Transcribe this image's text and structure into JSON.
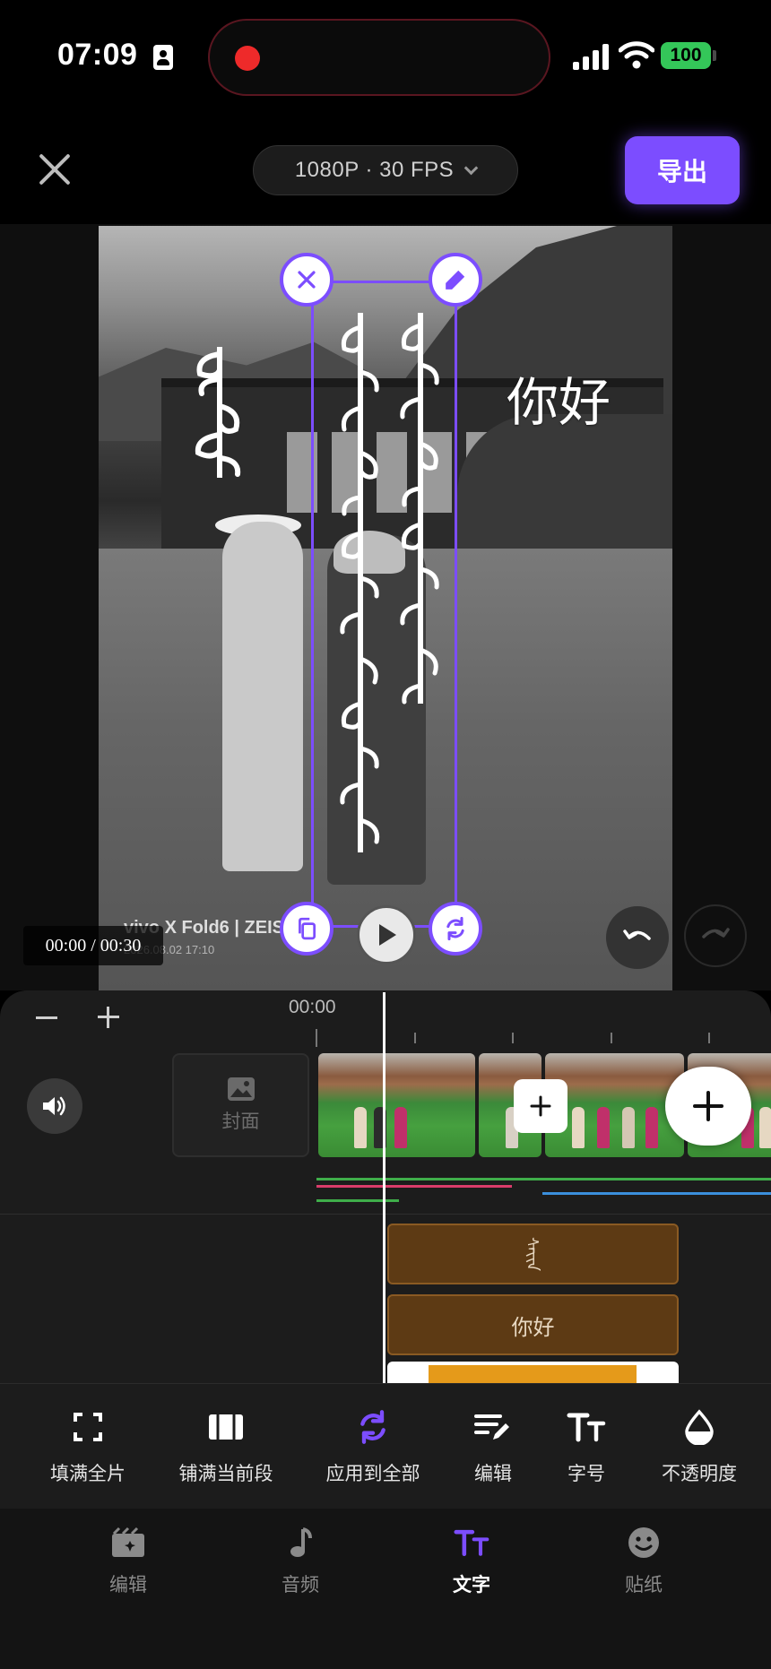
{
  "status_bar": {
    "time": "07:09",
    "battery": "100"
  },
  "toolbar": {
    "resolution": "1080P · 30 FPS",
    "export_label": "导出"
  },
  "preview": {
    "overlay_texts": {
      "nihao": "你好"
    },
    "watermark": "vivo X Fold6 | ZEISS",
    "watermark_date": "2026.08.02 17:10",
    "time_readout": "00:00 / 00:30"
  },
  "timeline": {
    "ruler_time": "00:00",
    "cover_label": "封面",
    "text_tracks": [
      {
        "label": "ᠰᠠᠶ᠋ᠢᠨ"
      },
      {
        "label": "你好"
      }
    ]
  },
  "tools": [
    {
      "label": "填满全片",
      "icon": "fill-frame-icon"
    },
    {
      "label": "铺满当前段",
      "icon": "fill-segment-icon"
    },
    {
      "label": "应用到全部",
      "icon": "apply-all-icon"
    },
    {
      "label": "编辑",
      "icon": "edit-text-icon"
    },
    {
      "label": "字号",
      "icon": "font-size-icon"
    },
    {
      "label": "不透明度",
      "icon": "opacity-icon"
    }
  ],
  "bottom_nav": [
    {
      "label": "编辑",
      "icon": "edit-clip-icon"
    },
    {
      "label": "音频",
      "icon": "music-note-icon"
    },
    {
      "label": "文字",
      "icon": "text-icon",
      "active": true
    },
    {
      "label": "贴纸",
      "icon": "smiley-icon"
    }
  ],
  "colors": {
    "accent": "#7c4dff",
    "record": "#ee2a2a",
    "battery": "#34c759",
    "text_clip": "#5d3a14"
  }
}
